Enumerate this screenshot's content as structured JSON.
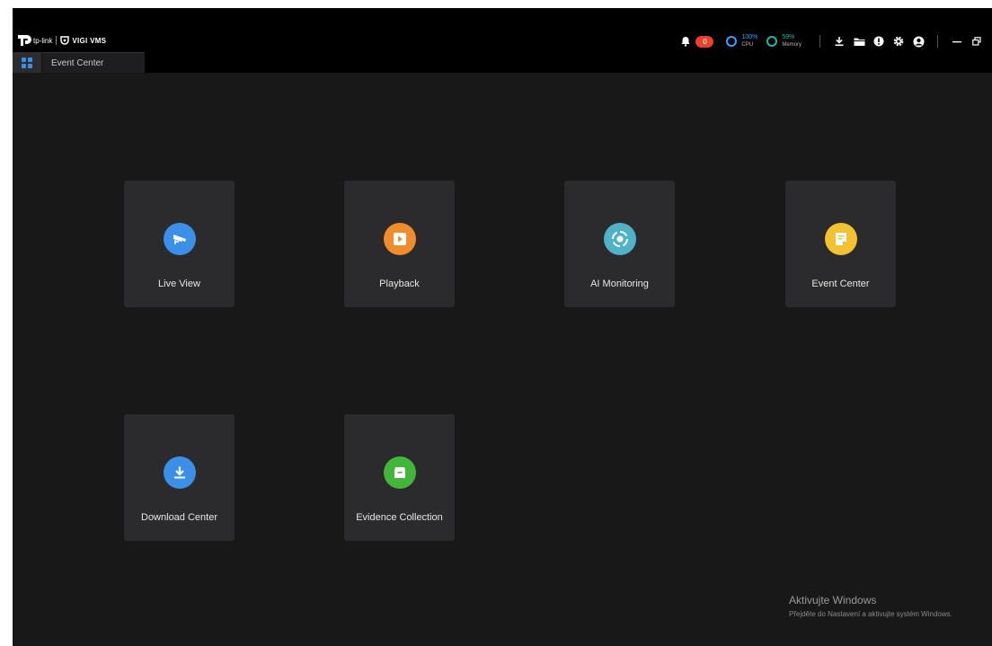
{
  "header": {
    "logo": {
      "tp_text": "tp-link",
      "vigi_text": "VIGI VMS"
    },
    "tab_label": "Event Center",
    "notifications": {
      "count": "0"
    },
    "cpu": {
      "percent": "100%",
      "label": "CPU"
    },
    "memory": {
      "percent": "59%",
      "label": "Memory"
    },
    "toolbar_icons": [
      "download-icon",
      "folder-icon",
      "info-icon",
      "gear-icon",
      "avatar-icon",
      "minimize-icon",
      "restore-icon"
    ]
  },
  "modules": [
    {
      "label": "Live View",
      "icon": "camera-icon",
      "color": "#3b8fe6"
    },
    {
      "label": "Playback",
      "icon": "play-icon",
      "color": "#f08c2c"
    },
    {
      "label": "AI Monitoring",
      "icon": "ai-target-icon",
      "color": "#4fb2c7"
    },
    {
      "label": "Event Center",
      "icon": "note-icon",
      "color": "#f3c232"
    },
    {
      "label": "Download Center",
      "icon": "download-icon",
      "color": "#3b8fe6"
    },
    {
      "label": "Evidence Collection",
      "icon": "archive-icon",
      "color": "#43b53b"
    }
  ],
  "watermark": {
    "title": "Aktivujte Windows",
    "subtitle": "Přejděte do Nastavení a aktivujte systém Windows."
  },
  "colors": {
    "background": "#181818",
    "tile": "#2b2b2d",
    "alert": "#e8412c",
    "cpu": "#3aa0ff",
    "memory": "#25b8a5"
  }
}
